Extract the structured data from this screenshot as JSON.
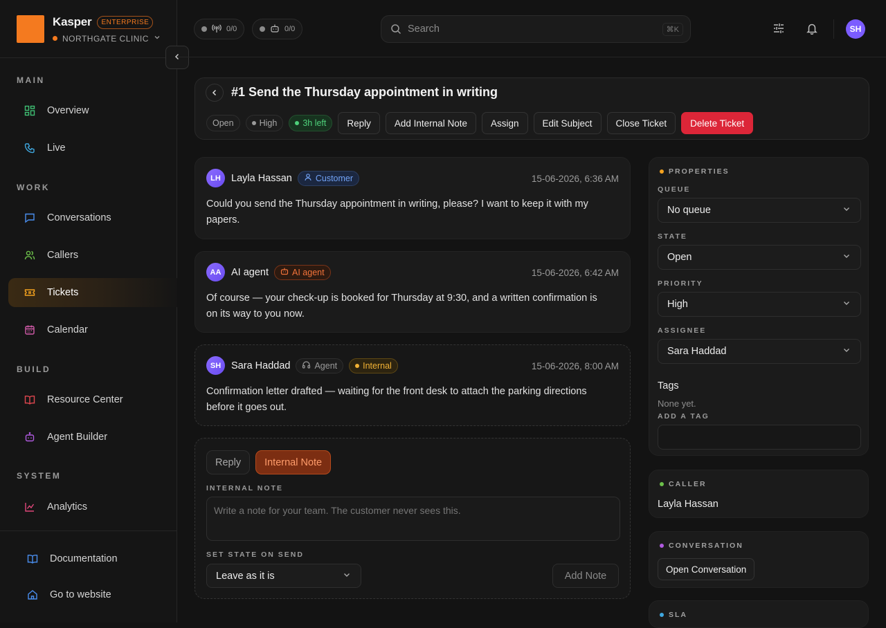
{
  "brand": {
    "name": "Kasper",
    "tier": "ENTERPRISE",
    "org": "NORTHGATE CLINIC"
  },
  "nav": {
    "sections": {
      "main": "MAIN",
      "work": "WORK",
      "build": "BUILD",
      "system": "SYSTEM"
    },
    "items": [
      {
        "label": "Overview",
        "icon": "grid-icon"
      },
      {
        "label": "Live",
        "icon": "phone-icon"
      },
      {
        "label": "Conversations",
        "icon": "chat-icon"
      },
      {
        "label": "Callers",
        "icon": "users-icon"
      },
      {
        "label": "Tickets",
        "icon": "ticket-icon",
        "active": true
      },
      {
        "label": "Calendar",
        "icon": "calendar-icon"
      },
      {
        "label": "Resource Center",
        "icon": "book-icon"
      },
      {
        "label": "Agent Builder",
        "icon": "bot-icon"
      },
      {
        "label": "Analytics",
        "icon": "chart-icon"
      }
    ],
    "footer": [
      {
        "label": "Documentation",
        "icon": "book-open-icon"
      },
      {
        "label": "Go to website",
        "icon": "home-icon"
      }
    ]
  },
  "topbar": {
    "live_calls": "0/0",
    "ai_agents": "0/0",
    "search_placeholder": "Search",
    "search_shortcut": "⌘K",
    "user_initials": "SH"
  },
  "ticket": {
    "title": "#1 Send the Thursday appointment in writing",
    "status": "Open",
    "priority": "High",
    "sla": "3h left",
    "actions": [
      "Reply",
      "Add Internal Note",
      "Assign",
      "Edit Subject",
      "Close Ticket",
      "Delete Ticket"
    ]
  },
  "messages": [
    {
      "initials": "LH",
      "name": "Layla Hassan",
      "role": "Customer",
      "time": "15-06-2026, 6:36 AM",
      "body": "Could you send the Thursday appointment in writing, please? I want to keep it with my papers."
    },
    {
      "initials": "AA",
      "name": "AI agent",
      "role": "AI agent",
      "time": "15-06-2026, 6:42 AM",
      "body": "Of course — your check-up is booked for Thursday at 9:30, and a written confirmation is on its way to you now."
    },
    {
      "initials": "SH",
      "name": "Sara Haddad",
      "role": "Agent",
      "tag": "Internal",
      "time": "15-06-2026, 8:00 AM",
      "body": "Confirmation letter drafted — waiting for the front desk to attach the parking directions before it goes out."
    }
  ],
  "composer": {
    "tabs": [
      "Reply",
      "Internal Note"
    ],
    "note_label": "INTERNAL NOTE",
    "note_placeholder": "Write a note for your team. The customer never sees this.",
    "state_label": "SET STATE ON SEND",
    "state_value": "Leave as it is",
    "submit": "Add Note"
  },
  "properties": {
    "header": "PROPERTIES",
    "queue_label": "QUEUE",
    "queue": "No queue",
    "state_label": "STATE",
    "state": "Open",
    "priority_label": "PRIORITY",
    "priority": "High",
    "assignee_label": "ASSIGNEE",
    "assignee": "Sara Haddad",
    "tags_label": "Tags",
    "tags_empty": "None yet.",
    "add_tag_label": "ADD A TAG"
  },
  "caller": {
    "header": "CALLER",
    "name": "Layla Hassan"
  },
  "conversation": {
    "header": "CONVERSATION",
    "button": "Open Conversation"
  },
  "sla": {
    "header": "SLA"
  },
  "colors": {
    "accent": "#f47a1f",
    "danger": "#dc2638",
    "internal": "#f2b235",
    "customer": "#72a3f5"
  }
}
